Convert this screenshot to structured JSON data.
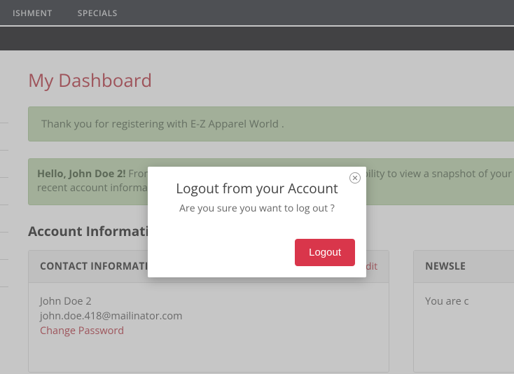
{
  "nav": {
    "item1": "ISHMENT",
    "item2": "SPECIALS"
  },
  "page_title": "My Dashboard",
  "thankyou": "Thank you for registering with E-Z Apparel World .",
  "hello": {
    "greeting": "Hello, John Doe 2!",
    "body": "From your My Account Dashboard you have the ability to view a snapshot of your recent account information."
  },
  "account_section_title": "Account Information",
  "contact_card": {
    "title": "CONTACT INFORMATION",
    "edit": "Edit",
    "name": "John Doe 2",
    "email": "john.doe.418@mailinator.com",
    "change_pw": "Change Password"
  },
  "newsletter_card": {
    "title_fragment": "NEWSLE",
    "body_fragment": "You are c"
  },
  "modal": {
    "title": "Logout from your Account",
    "message": "Are you sure you want to log out ?",
    "button": "Logout"
  }
}
